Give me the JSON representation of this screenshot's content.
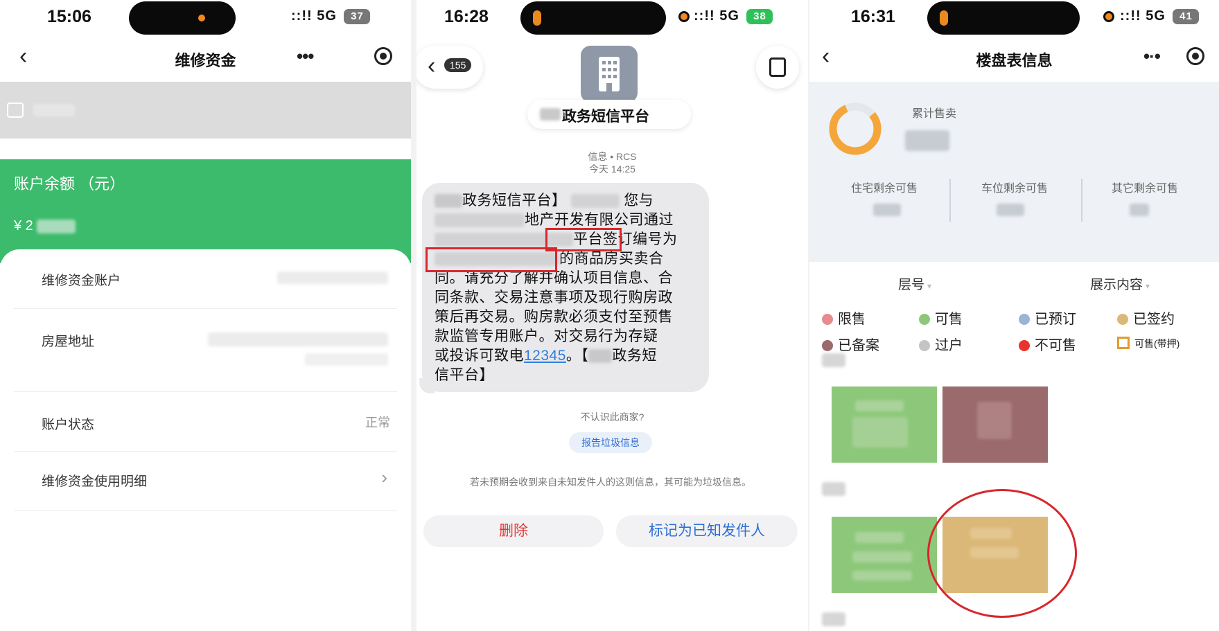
{
  "colors": {
    "green_card": "#3dbb6c",
    "alert_red": "#d9262c",
    "link_blue": "#2f7de1",
    "status_limited": "#e88b8f",
    "status_available": "#8dc87a",
    "status_reserved": "#9bb3d8",
    "status_signed": "#dcb878",
    "status_filed": "#9b6a6c",
    "status_transferred": "#c4c4c4",
    "status_not_for_sale": "#e8332f",
    "status_available_mortgaged": "#e39b2e"
  },
  "panel1": {
    "status_time": "15:06",
    "signal": "5G",
    "battery": "37",
    "back_icon": "chevron-left-icon",
    "title": "维修资金",
    "more_icon": "more-dots-icon",
    "close_icon": "target-close-icon",
    "balance_label": "账户余额 （元）",
    "balance_amount": "¥ 2",
    "rows": [
      {
        "key": "维修资金账户",
        "value": ""
      },
      {
        "key": "房屋地址",
        "value": ""
      },
      {
        "key": "账户状态",
        "value": "正常"
      },
      {
        "key": "维修资金使用明细",
        "value": ""
      }
    ]
  },
  "panel2": {
    "status_time": "16:28",
    "signal": "5G",
    "battery": "38",
    "unread_count": "155",
    "sender": "政务短信平台",
    "channel": "信息 • RCS",
    "timestamp": "今天 14:25",
    "message": {
      "line1": "政务短信平台】",
      "line1b": "您与",
      "line2": "地产开发有限公司通过",
      "line3": "平台",
      "line3_boxed": "签订编号为",
      "line4": "的商品房买卖合",
      "line5": "同。请充分了解并确认项目信息、合",
      "line6": "同条款、交易注意事项及现行购房政",
      "line7": "策后再交易。购房款必须支付至预售",
      "line8": "款监管专用账户。对交易行为存疑",
      "line9_pre": "或投诉可致电",
      "hotline": "12345",
      "line9_post": "。【",
      "line9_tail": "政务短",
      "line10": "信平台】"
    },
    "unknown_sender": "不认识此商家?",
    "report_label": "报告垃圾信息",
    "warning": "若未预期会收到来自未知发件人的这则信息，其可能为垃圾信息。",
    "delete_label": "删除",
    "mark_known_label": "标记为已知发件人"
  },
  "panel3": {
    "status_time": "16:31",
    "signal": "5G",
    "battery": "41",
    "title": "楼盘表信息",
    "cumulative_label": "累计售卖",
    "stats": [
      {
        "label": "住宅剩余可售"
      },
      {
        "label": "车位剩余可售"
      },
      {
        "label": "其它剩余可售"
      }
    ],
    "floor_selector": "层号",
    "display_selector": "展示内容",
    "legend": [
      {
        "label": "限售",
        "color_key": "status_limited"
      },
      {
        "label": "可售",
        "color_key": "status_available"
      },
      {
        "label": "已预订",
        "color_key": "status_reserved"
      },
      {
        "label": "已签约",
        "color_key": "status_signed"
      },
      {
        "label": "已备案",
        "color_key": "status_filed"
      },
      {
        "label": "过户",
        "color_key": "status_transferred"
      },
      {
        "label": "不可售",
        "color_key": "status_not_for_sale"
      },
      {
        "label": "可售(带押)",
        "color_key": "status_available_mortgaged"
      }
    ]
  }
}
